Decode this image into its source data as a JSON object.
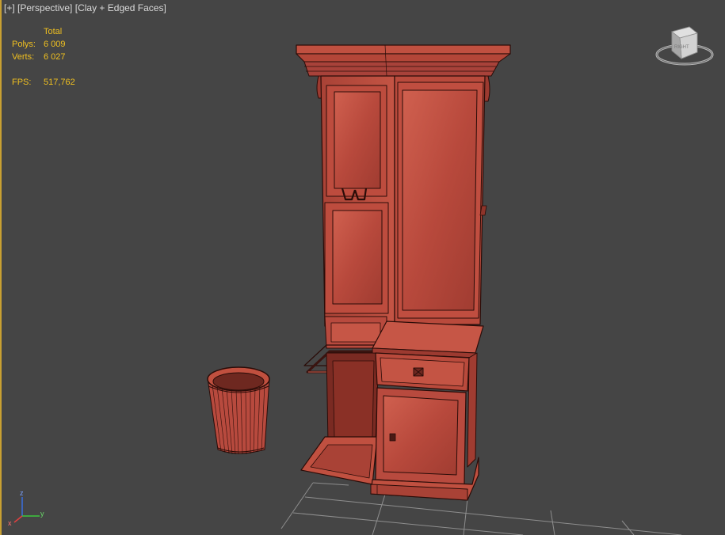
{
  "viewport": {
    "label_plus": "[+]",
    "label_view": "[Perspective]",
    "label_shading": "[Clay + Edged Faces]"
  },
  "stats": {
    "header": "Total",
    "polys_label": "Polys:",
    "polys_value": "6 009",
    "verts_label": "Verts:",
    "verts_value": "6 027",
    "fps_label": "FPS:",
    "fps_value": "517,762"
  },
  "viewcube": {
    "face_label": "RIGHT"
  },
  "axis": {
    "z": "z",
    "y": "y",
    "x": "x"
  },
  "colors": {
    "background": "#454545",
    "clay": "#b84a3e",
    "clay_light": "#cc5a4c",
    "wire": "#2a0c08",
    "grid": "#8c8c8c",
    "stats_text": "#f0c020",
    "active_border": "#c8a032"
  }
}
